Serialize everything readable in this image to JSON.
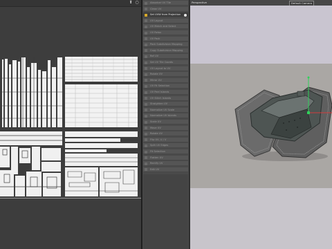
{
  "uv_editor": {
    "toolbar_icons": [
      "pin-icon",
      "circle-icon"
    ],
    "checker_color": "#f2f2f2"
  },
  "scene_tree": {
    "items": [
      {
        "label": "Absorber UV Tile",
        "selected": false
      },
      {
        "label": "Clean UV",
        "selected": false
      },
      {
        "label": "Set UVW from Projection",
        "selected": true
      },
      {
        "label": "UV Layout",
        "selected": false
      },
      {
        "label": "UV Match and Select",
        "selected": false
      },
      {
        "label": "UV Relax",
        "selected": false
      },
      {
        "label": "UV Pack",
        "selected": false
      },
      {
        "label": "Pack Subdivision Mapping",
        "selected": false
      },
      {
        "label": "Copy Subdivision Mapping",
        "selected": false
      },
      {
        "label": "Ref UV",
        "selected": false
      },
      {
        "label": "Set UV Tile Coords",
        "selected": false
      },
      {
        "label": "UV Layout to UV",
        "selected": false
      },
      {
        "label": "Rotate UV",
        "selected": false
      },
      {
        "label": "Mirror UV",
        "selected": false
      },
      {
        "label": "UV Fit Selection",
        "selected": false
      },
      {
        "label": "UV Peel Islands",
        "selected": false
      },
      {
        "label": "UV Stitch Islands",
        "selected": false
      },
      {
        "label": "Straighten UV",
        "selected": false
      },
      {
        "label": "Normalize UV Scale",
        "selected": false
      },
      {
        "label": "Normalize UV Islands",
        "selected": false
      },
      {
        "label": "Scale UV",
        "selected": false
      },
      {
        "label": "Move UV",
        "selected": false
      },
      {
        "label": "Rotate UV",
        "selected": false
      },
      {
        "label": "Flip UV, U / V",
        "selected": false
      },
      {
        "label": "Split UV Edges",
        "selected": false
      },
      {
        "label": "Fit Selection",
        "selected": false
      },
      {
        "label": "Flatten UV",
        "selected": false
      },
      {
        "label": "Rectify UV",
        "selected": false
      },
      {
        "label": "Edit UV",
        "selected": false
      }
    ]
  },
  "viewport": {
    "view_name": "Perspective",
    "camera_label": "Default Camera",
    "sky_color": "#c9c5d0",
    "floor_color": "#aaa7a4",
    "gizmo_colors": {
      "x": "#d43b3b",
      "y": "#2fd15a"
    }
  }
}
